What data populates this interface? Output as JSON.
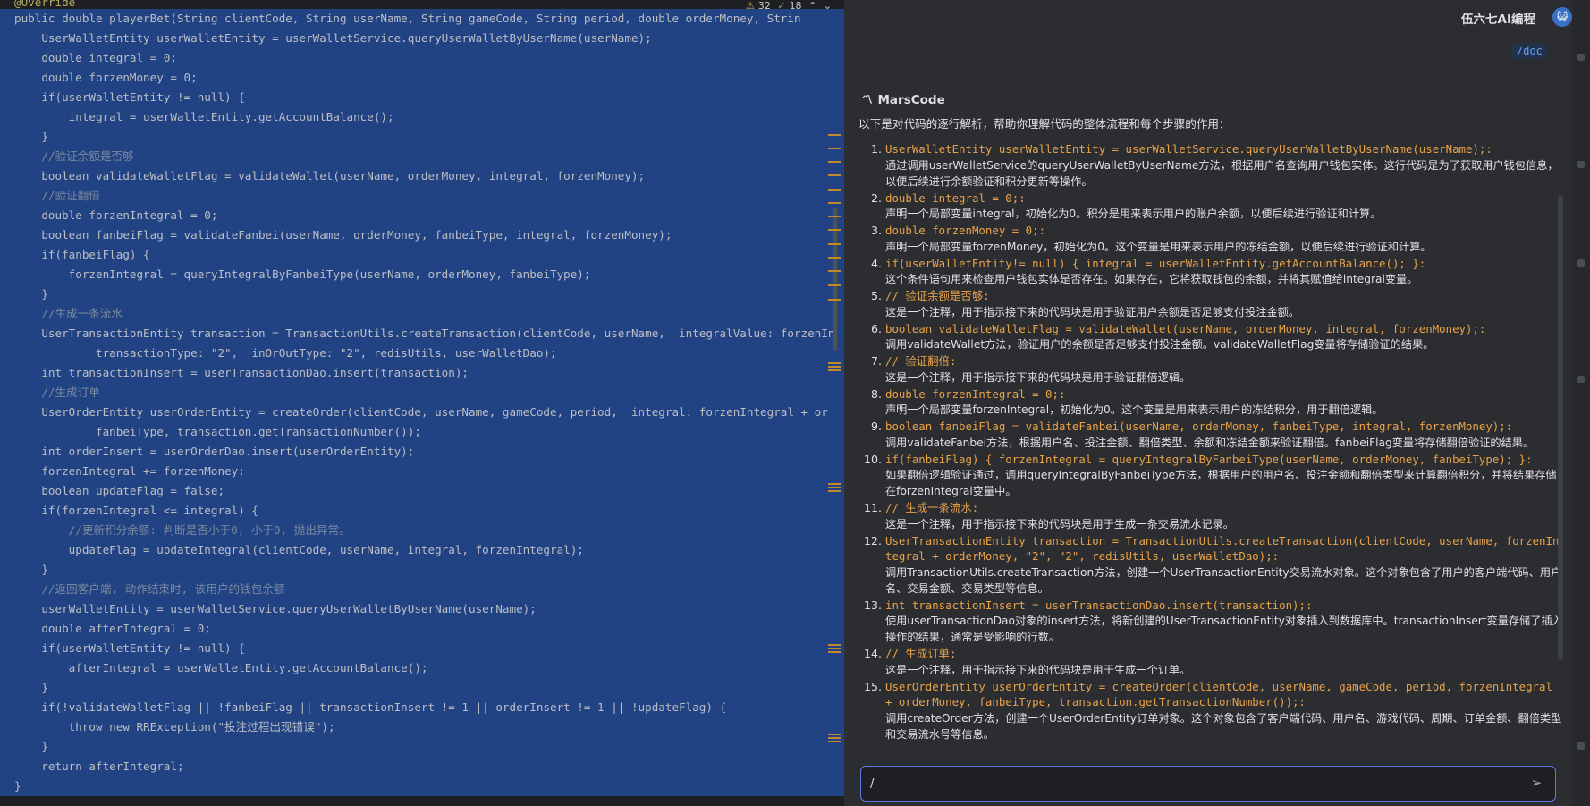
{
  "editor": {
    "inspections": {
      "warnings": "32",
      "ok": "18"
    },
    "lines": [
      {
        "text": "@Override",
        "sel": false,
        "color": "#b3ae60"
      },
      {
        "text": "public double playerBet(String clientCode, String userName, String gameCode, String period, double orderMoney, Strin",
        "sel": true,
        "inset": false
      },
      {
        "text": "    UserWalletEntity userWalletEntity = userWalletService.queryUserWalletByUserName(userName);",
        "sel": true
      },
      {
        "text": "    double integral = 0;",
        "sel": true
      },
      {
        "text": "    double forzenMoney = 0;",
        "sel": true
      },
      {
        "text": "    if(userWalletEntity != null) {",
        "sel": true
      },
      {
        "text": "        integral = userWalletEntity.getAccountBalance();",
        "sel": true
      },
      {
        "text": "    }",
        "sel": true
      },
      {
        "text": "    //验证余额是否够",
        "sel": true,
        "color": "#7a8a9e"
      },
      {
        "text": "    boolean validateWalletFlag = validateWallet(userName, orderMoney, integral, forzenMoney);",
        "sel": true
      },
      {
        "text": "    //验证翻倍",
        "sel": true,
        "color": "#7a8a9e"
      },
      {
        "text": "    double forzenIntegral = 0;",
        "sel": true
      },
      {
        "text": "    boolean fanbeiFlag = validateFanbei(userName, orderMoney, fanbeiType, integral, forzenMoney);",
        "sel": true
      },
      {
        "text": "    if(fanbeiFlag) {",
        "sel": true
      },
      {
        "text": "        forzenIntegral = queryIntegralByFanbeiType(userName, orderMoney, fanbeiType);",
        "sel": true
      },
      {
        "text": "    }",
        "sel": true
      },
      {
        "text": "    //生成一条流水",
        "sel": true,
        "color": "#7a8a9e"
      },
      {
        "text": "    UserTransactionEntity transaction = TransactionUtils.createTransaction(clientCode, userName,  integralValue: forzenIn",
        "sel": true
      },
      {
        "text": "            transactionType: \"2\",  inOrOutType: \"2\", redisUtils, userWalletDao);",
        "sel": true
      },
      {
        "text": "    int transactionInsert = userTransactionDao.insert(transaction);",
        "sel": true
      },
      {
        "text": "    //生成订单",
        "sel": true,
        "color": "#7a8a9e"
      },
      {
        "text": "    UserOrderEntity userOrderEntity = createOrder(clientCode, userName, gameCode, period,  integral: forzenIntegral + or",
        "sel": true
      },
      {
        "text": "            fanbeiType, transaction.getTransactionNumber());",
        "sel": true
      },
      {
        "text": "    int orderInsert = userOrderDao.insert(userOrderEntity);",
        "sel": true
      },
      {
        "text": "    forzenIntegral += forzenMoney;",
        "sel": true
      },
      {
        "text": "    boolean updateFlag = false;",
        "sel": true
      },
      {
        "text": "    if(forzenIntegral <= integral) {",
        "sel": true
      },
      {
        "text": "        //更新积分余额: 判断是否小于0, 小于0, 抛出异常。",
        "sel": true,
        "color": "#7a8a9e"
      },
      {
        "text": "        updateFlag = updateIntegral(clientCode, userName, integral, forzenIntegral);",
        "sel": true
      },
      {
        "text": "    }",
        "sel": true
      },
      {
        "text": "    //返回客户端, 动作结束时, 该用户的钱包余额",
        "sel": true,
        "color": "#7a8a9e"
      },
      {
        "text": "    userWalletEntity = userWalletService.queryUserWalletByUserName(userName);",
        "sel": true
      },
      {
        "text": "    double afterIntegral = 0;",
        "sel": true
      },
      {
        "text": "    if(userWalletEntity != null) {",
        "sel": true
      },
      {
        "text": "        afterIntegral = userWalletEntity.getAccountBalance();",
        "sel": true
      },
      {
        "text": "    }",
        "sel": true
      },
      {
        "text": "    if(!validateWalletFlag || !fanbeiFlag || transactionInsert != 1 || orderInsert != 1 || !updateFlag) {",
        "sel": true
      },
      {
        "text": "        throw new RRException(\"投注过程出现错误\");",
        "sel": true
      },
      {
        "text": "    }",
        "sel": true
      },
      {
        "text": "    return afterIntegral;",
        "sel": true
      },
      {
        "text": "}",
        "sel": true
      }
    ]
  },
  "chat": {
    "title": "伍六七AI编程",
    "avatar": "😺",
    "doc_chip": "/doc",
    "brand": "MarsCode",
    "brand_icon": "〽",
    "intro": "以下是对代码的逐行解析，帮助你理解代码的整体流程和每个步骤的作用：",
    "items": [
      {
        "n": "1.",
        "code": "UserWalletEntity userWalletEntity = userWalletService.queryUserWalletByUserName(userName);:",
        "desc": "通过调用userWalletService的queryUserWalletByUserName方法，根据用户名查询用户钱包实体。这行代码是为了获取用户钱包信息，以便后续进行余额验证和积分更新等操作。"
      },
      {
        "n": "2.",
        "code": "double integral = 0;:",
        "desc": "声明一个局部变量integral，初始化为0。积分是用来表示用户的账户余额，以便后续进行验证和计算。"
      },
      {
        "n": "3.",
        "code": "double forzenMoney = 0;:",
        "desc": "声明一个局部变量forzenMoney，初始化为0。这个变量是用来表示用户的冻结金额，以便后续进行验证和计算。"
      },
      {
        "n": "4.",
        "code": "if(userWalletEntity!= null) { integral = userWalletEntity.getAccountBalance(); }:",
        "desc": "这个条件语句用来检查用户钱包实体是否存在。如果存在，它将获取钱包的余额，并将其赋值给integral变量。"
      },
      {
        "n": "5.",
        "code": "// 验证余额是否够:",
        "desc": "这是一个注释，用于指示接下来的代码块是用于验证用户余额是否足够支付投注金额。"
      },
      {
        "n": "6.",
        "code": "boolean validateWalletFlag = validateWallet(userName, orderMoney, integral, forzenMoney);:",
        "desc": "调用validateWallet方法，验证用户的余额是否足够支付投注金额。validateWalletFlag变量将存储验证的结果。"
      },
      {
        "n": "7.",
        "code": "// 验证翻倍:",
        "desc": "这是一个注释，用于指示接下来的代码块是用于验证翻倍逻辑。"
      },
      {
        "n": "8.",
        "code": "double forzenIntegral = 0;:",
        "desc": "声明一个局部变量forzenIntegral，初始化为0。这个变量是用来表示用户的冻结积分，用于翻倍逻辑。"
      },
      {
        "n": "9.",
        "code": "boolean fanbeiFlag = validateFanbei(userName, orderMoney, fanbeiType, integral, forzenMoney);:",
        "desc": "调用validateFanbei方法，根据用户名、投注金额、翻倍类型、余额和冻结金额来验证翻倍。fanbeiFlag变量将存储翻倍验证的结果。"
      },
      {
        "n": "10.",
        "code": "if(fanbeiFlag) { forzenIntegral = queryIntegralByFanbeiType(userName, orderMoney, fanbeiType); }:",
        "desc": "如果翻倍逻辑验证通过，调用queryIntegralByFanbeiType方法，根据用户的用户名、投注金额和翻倍类型来计算翻倍积分，并将结果存储在forzenIntegral变量中。"
      },
      {
        "n": "11.",
        "code": "// 生成一条流水:",
        "desc": "这是一个注释，用于指示接下来的代码块是用于生成一条交易流水记录。"
      },
      {
        "n": "12.",
        "code": "UserTransactionEntity transaction = TransactionUtils.createTransaction(clientCode, userName, forzenIntegral + orderMoney, \"2\", \"2\", redisUtils, userWalletDao);:",
        "desc": "调用TransactionUtils.createTransaction方法，创建一个UserTransactionEntity交易流水对象。这个对象包含了用户的客户端代码、用户名、交易金额、交易类型等信息。"
      },
      {
        "n": "13.",
        "code": "int transactionInsert = userTransactionDao.insert(transaction);:",
        "desc": "使用userTransactionDao对象的insert方法，将新创建的UserTransactionEntity对象插入到数据库中。transactionInsert变量存储了插入操作的结果，通常是受影响的行数。"
      },
      {
        "n": "14.",
        "code": "// 生成订单:",
        "desc": "这是一个注释，用于指示接下来的代码块是用于生成一个订单。"
      },
      {
        "n": "15.",
        "code": "UserOrderEntity userOrderEntity = createOrder(clientCode, userName, gameCode, period, forzenIntegral + orderMoney, fanbeiType, transaction.getTransactionNumber());:",
        "desc": "调用createOrder方法，创建一个UserOrderEntity订单对象。这个对象包含了客户端代码、用户名、游戏代码、周期、订单金额、翻倍类型和交易流水号等信息。"
      }
    ],
    "input": {
      "value": "/",
      "placeholder": ""
    },
    "send_icon": "➢"
  }
}
